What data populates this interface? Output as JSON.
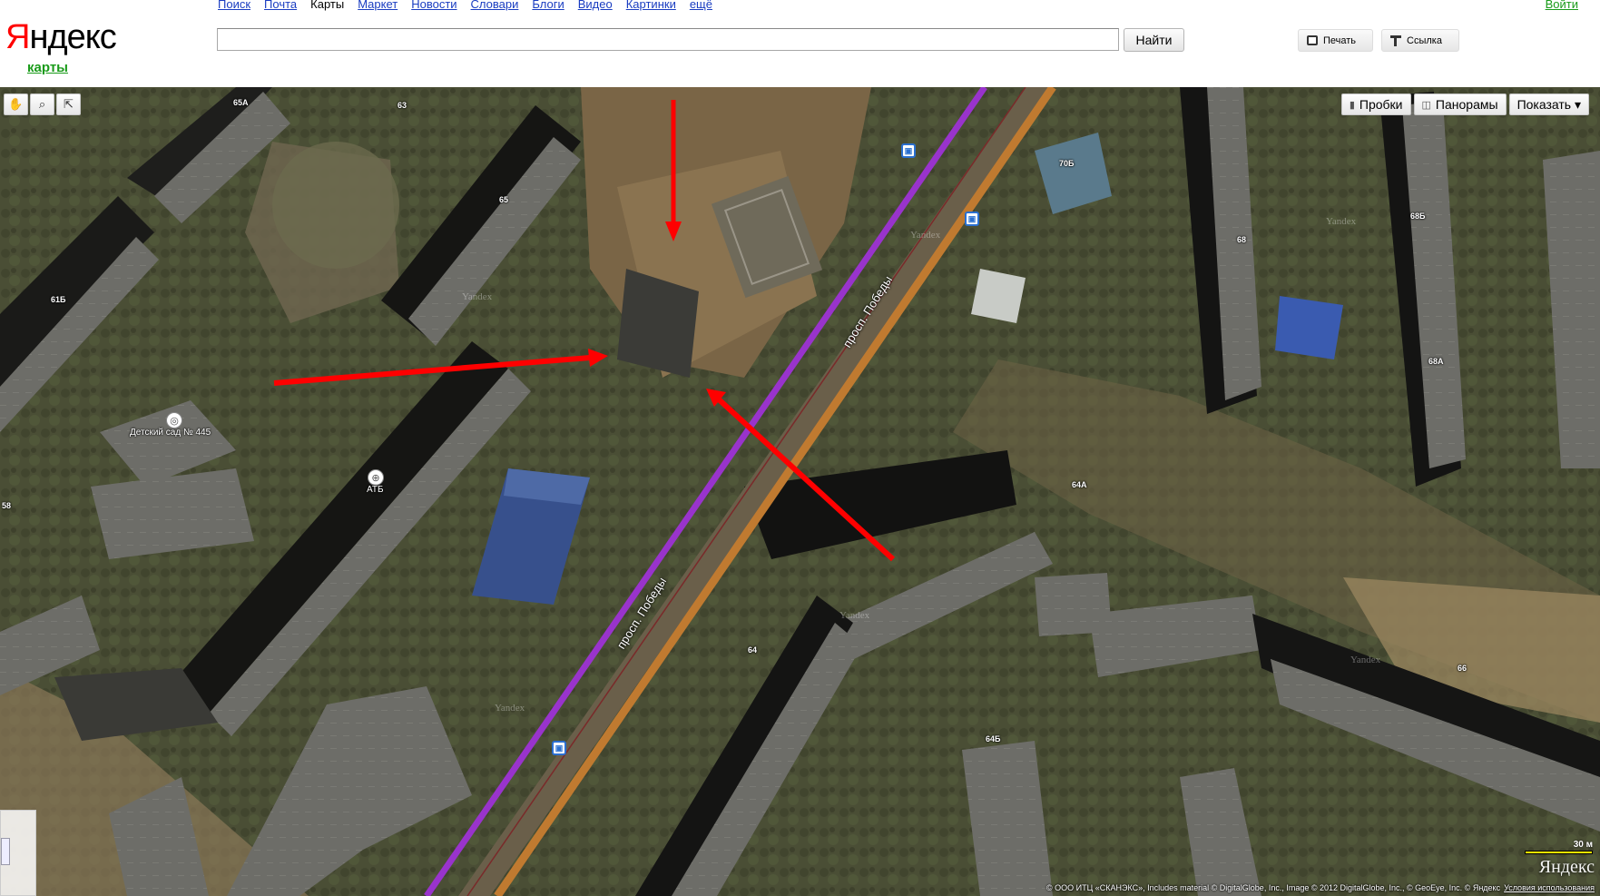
{
  "header": {
    "logo_initial": "Я",
    "logo_rest": "ндекс",
    "service": "карты",
    "nav": [
      "Поиск",
      "Почта",
      "Карты",
      "Маркет",
      "Новости",
      "Словари",
      "Блоги",
      "Видео",
      "Картинки",
      "ещё"
    ],
    "active_nav": "Карты",
    "login": "Войти",
    "search": {
      "value": "",
      "placeholder": ""
    },
    "search_button": "Найти",
    "print_button": "Печать",
    "link_button": "Ссылка"
  },
  "map": {
    "tools": [
      "hand-pan-icon",
      "magnifier-icon",
      "ruler-icon"
    ],
    "controls": {
      "traffic": "Пробки",
      "panoramas": "Панорамы",
      "show": "Показать ▾"
    },
    "street_labels": [
      "просп. Победы",
      "просп. Победы"
    ],
    "building_numbers": [
      "65А",
      "63",
      "65",
      "61Б",
      "58",
      "70Б",
      "68Б",
      "68",
      "68А",
      "64А",
      "64",
      "64Б",
      "66"
    ],
    "poi_labels": {
      "kindergarten": "Детский сад № 445",
      "shop": "АТБ"
    },
    "watermark": "Yandex",
    "scale_label": "30 м",
    "map_logo": "Яндекс",
    "copyright": "© ООО ИТЦ «СКАНЭКС», Includes material © DigitalGlobe, Inc., Image © 2012 DigitalGlobe, Inc., © GeoEye, Inc. © Яндекс",
    "terms_link": "Условия использования",
    "colors": {
      "annotation_arrow": "#ff0000",
      "tram_line": "#9933cc",
      "road": "#c07a30"
    }
  }
}
